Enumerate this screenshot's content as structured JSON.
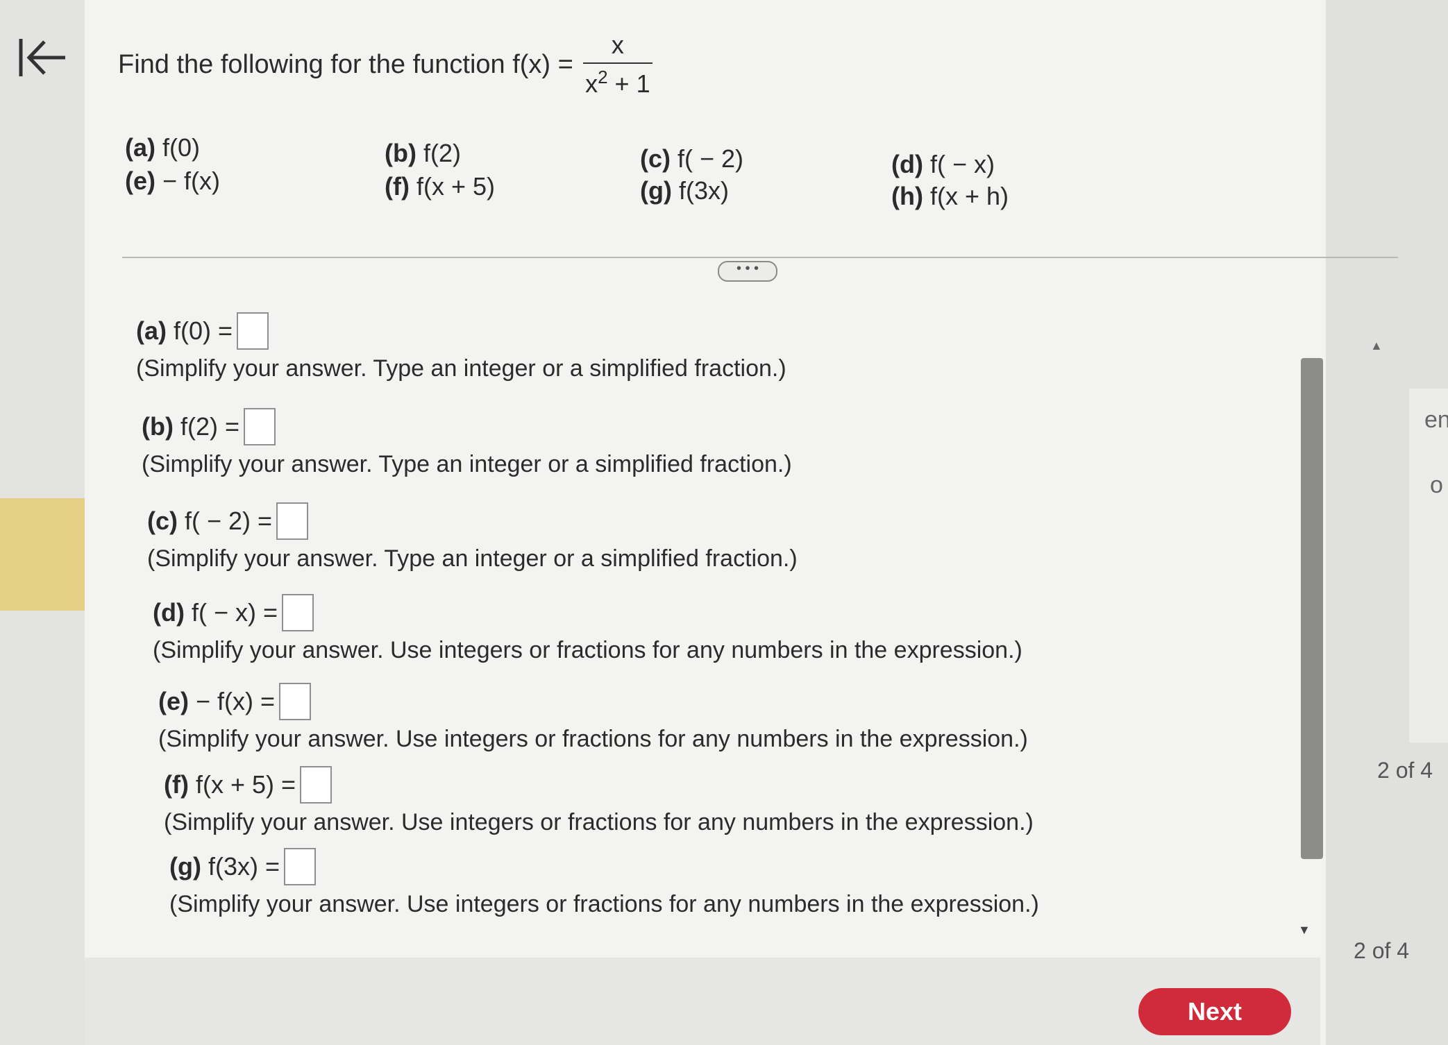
{
  "question": {
    "prefix": "Find the following for the function f(x) =",
    "numerator": "x",
    "denominator_base": "x",
    "denominator_exp": "2",
    "denominator_rest": " + 1"
  },
  "parts": [
    {
      "letter": "(a)",
      "expr": "f(0)"
    },
    {
      "letter": "(b)",
      "expr": "f(2)"
    },
    {
      "letter": "(c)",
      "expr": "f( − 2)"
    },
    {
      "letter": "(d)",
      "expr": "f( − x)"
    },
    {
      "letter": "(e)",
      "expr": "− f(x)"
    },
    {
      "letter": "(f)",
      "expr": "f(x + 5)"
    },
    {
      "letter": "(g)",
      "expr": "f(3x)"
    },
    {
      "letter": "(h)",
      "expr": "f(x + h)"
    }
  ],
  "more_button": "• • •",
  "answers": [
    {
      "letter": "(a)",
      "expr": "f(0) =",
      "hint": "(Simplify your answer. Type an integer or a simplified fraction.)"
    },
    {
      "letter": "(b)",
      "expr": "f(2) =",
      "hint": "(Simplify your answer. Type an integer or a simplified fraction.)"
    },
    {
      "letter": "(c)",
      "expr": "f( − 2) =",
      "hint": "(Simplify your answer. Type an integer or a simplified fraction.)"
    },
    {
      "letter": "(d)",
      "expr": "f( − x) =",
      "hint": "(Simplify your answer. Use integers or fractions for any numbers in the expression.)"
    },
    {
      "letter": "(e)",
      "expr": "− f(x) =",
      "hint": "(Simplify your answer. Use integers or fractions for any numbers in the expression.)"
    },
    {
      "letter": "(f)",
      "expr": "f(x + 5) =",
      "hint": "(Simplify your answer. Use integers or fractions for any numbers in the expression.)"
    },
    {
      "letter": "(g)",
      "expr": "f(3x) =",
      "hint": "(Simplify your answer. Use integers or fractions for any numbers in the expression.)"
    }
  ],
  "page_counter_1": "2 of 4",
  "page_counter_2": "2 of 4",
  "edge_text_1": "en",
  "edge_text_2": "o",
  "next_label": "Next",
  "colors": {
    "accent": "#d12a3a",
    "top_bar": "#c8283a",
    "tab": "#e6cf87"
  }
}
